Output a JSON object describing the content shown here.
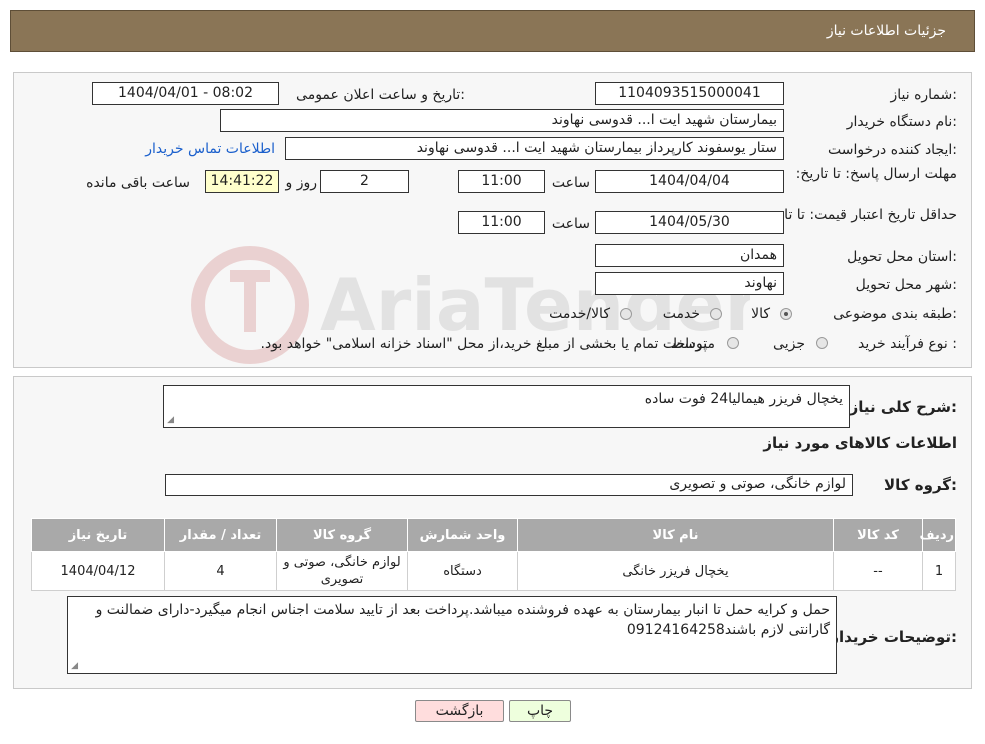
{
  "header": {
    "title": "جزئيات اطلاعات نياز"
  },
  "form": {
    "need_number": {
      "label": "شماره نیاز:",
      "value": "1104093515000041"
    },
    "announce_datetime": {
      "label": "تاریخ و ساعت اعلان عمومی:",
      "value": "1404/04/01 - 08:02"
    },
    "buyer_org": {
      "label": "نام دستگاه خریدار:",
      "value": "بیمارستان شهید ایت ا... قدوسی نهاوند"
    },
    "requester": {
      "label": "ایجاد کننده درخواست:",
      "value": "ستار یوسفوند کارپرداز بیمارستان شهید ایت ا... قدوسی نهاوند"
    },
    "contact_link": "اطلاعات تماس خریدار",
    "reply_deadline": {
      "label": "مهلت ارسال پاسخ: تا تاریخ:",
      "date": "1404/04/04",
      "time_label": "ساعت",
      "time": "11:00",
      "days": "2",
      "days_label": "روز و",
      "remaining": "14:41:22",
      "remaining_label": "ساعت باقی مانده"
    },
    "price_validity": {
      "label": "حداقل تاریخ اعتبار قیمت: تا تاریخ:",
      "date": "1404/05/30",
      "time_label": "ساعت",
      "time": "11:00"
    },
    "province": {
      "label": "استان محل تحویل:",
      "value": "همدان"
    },
    "city": {
      "label": "شهر محل تحویل:",
      "value": "نهاوند"
    },
    "category": {
      "label": "طبقه بندی موضوعی:",
      "options": [
        "کالا",
        "خدمت",
        "کالا/خدمت"
      ],
      "selected": "کالا"
    },
    "purchase_type": {
      "label": "نوع فرآیند خرید :",
      "options": [
        "جزیی",
        "متوسط"
      ],
      "note": "پرداخت تمام یا بخشی از مبلغ خرید،از محل \"اسناد خزانه اسلامی\" خواهد بود."
    }
  },
  "description": {
    "label": "شرح کلی نیاز:",
    "value": "یخچال فریزر هیمالیا24 فوت ساده"
  },
  "goods_info": {
    "title": "اطلاعات کالاهای مورد نیاز"
  },
  "goods_group": {
    "label": "گروه کالا:",
    "value": "لوازم خانگی، صوتی و تصویری"
  },
  "table": {
    "headers": [
      "ردیف",
      "کد کالا",
      "نام کالا",
      "واحد شمارش",
      "گروه کالا",
      "تعداد / مقدار",
      "تاریخ نیاز"
    ],
    "rows": [
      [
        "1",
        "--",
        "یخچال فریزر خانگی",
        "دستگاه",
        "لوازم خانگی، صوتی و تصویری",
        "4",
        "1404/04/12"
      ]
    ]
  },
  "buyer_notes": {
    "label": "توضیحات خریدار:",
    "value": "حمل و کرایه حمل تا انبار بیمارستان به عهده فروشنده میباشد.پرداخت بعد از تایید سلامت اجناس انجام میگیرد-دارای ضمالنت و گارانتی لازم باشند09124164258"
  },
  "buttons": {
    "print": "چاپ",
    "back": "بازگشت"
  },
  "colors": {
    "header_bg": "#8a7556",
    "table_header_bg": "#a9a9a9",
    "print_bg": "#eeffdd",
    "back_bg": "#ffdddd"
  }
}
